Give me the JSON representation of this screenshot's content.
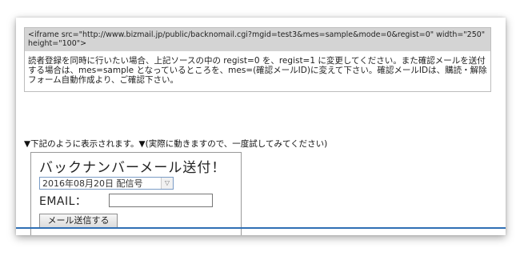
{
  "code_box": {
    "embed_code": "<iframe src=\"http://www.bizmail.jp/public/backnomail.cgi?mgid=test3&mes=sample&mode=0&regist=0\" width=\"250\" height=\"100\">",
    "description": "読者登録を同時に行いたい場合、上記ソースの中の regist=0 を、regist=1 に変更してください。また確認メールを送付する場合は、mes=sample となっているところを、mes=(確認メールID)に変えて下さい。確認メールIDは、購読・解除フォーム自動作成より、ご確認下さい。"
  },
  "caption": "▼下記のように表示されます。▼(実際に動きますので、一度試してみてください)",
  "widget": {
    "title": "バックナンバーメール送付！",
    "select_value": "2016年08月20日 配信号",
    "email_label": "EMAIL：",
    "email_value": "",
    "send_button": "メール送信する"
  },
  "colors": {
    "code_header_bg": "#d4d4d4",
    "select_border": "#7a9cc6",
    "rule": "#2f6fb4"
  }
}
